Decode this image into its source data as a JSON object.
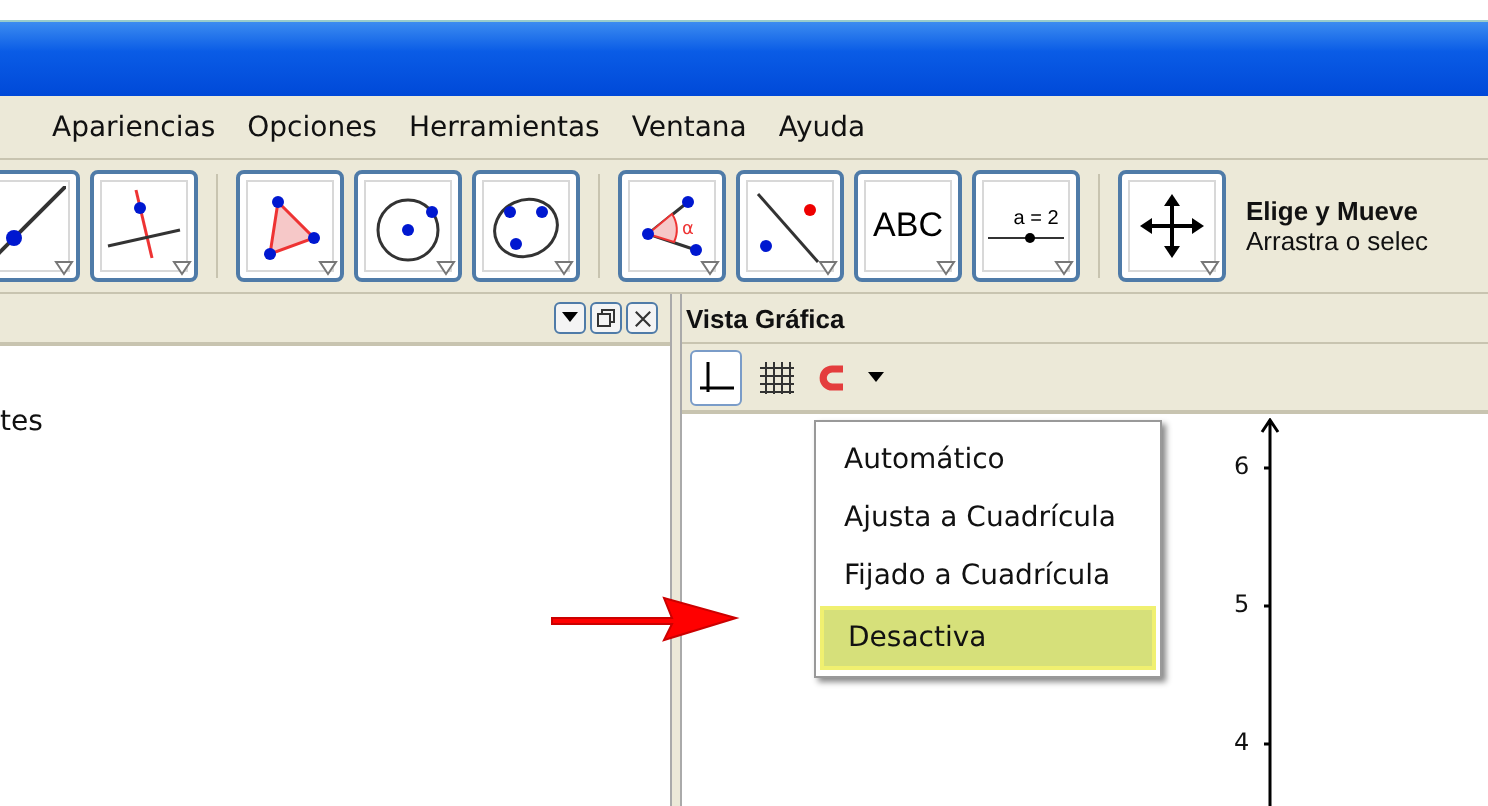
{
  "menu": [
    "Apariencias",
    "Opciones",
    "Herramientas",
    "Ventana",
    "Ayuda"
  ],
  "tools": [
    {
      "kind": "line"
    },
    {
      "kind": "perpendicular"
    },
    {
      "kind": "polygon"
    },
    {
      "kind": "circle"
    },
    {
      "kind": "conic"
    },
    {
      "kind": "angle",
      "symbol": "α"
    },
    {
      "kind": "reflect"
    },
    {
      "kind": "text",
      "label": "ABC"
    },
    {
      "kind": "slider",
      "label": "a = 2"
    },
    {
      "kind": "move"
    }
  ],
  "tool_help": {
    "title": "Elige y Mueve",
    "text": "Arrastra o selec"
  },
  "left_panel": {
    "text": "tes"
  },
  "graphics_view": {
    "title": "Vista Gráfica",
    "snap_menu": [
      {
        "label": "Automático",
        "selected": false
      },
      {
        "label": "Ajusta a Cuadrícula",
        "selected": false
      },
      {
        "label": "Fijado a Cuadrícula",
        "selected": false
      },
      {
        "label": "Desactiva",
        "selected": true
      }
    ],
    "y_axis_labels": [
      "6",
      "5",
      "4"
    ]
  }
}
